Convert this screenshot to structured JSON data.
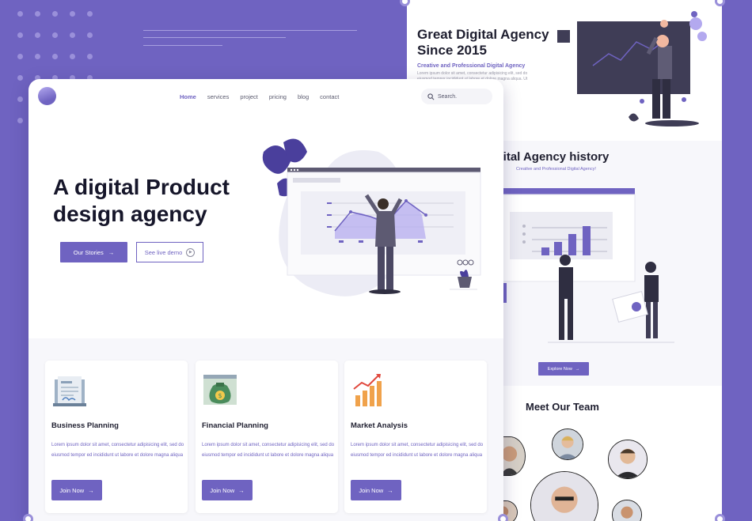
{
  "colors": {
    "brand": "#6f63c1",
    "background": "#6f63c1",
    "text_dark": "#1e1e2f"
  },
  "nav": {
    "items": [
      {
        "label": "Home",
        "active": true
      },
      {
        "label": "services",
        "active": false
      },
      {
        "label": "project",
        "active": false
      },
      {
        "label": "pricing",
        "active": false
      },
      {
        "label": "blog",
        "active": false
      },
      {
        "label": "contact",
        "active": false
      }
    ],
    "search_placeholder": "Search.",
    "search_icon": "search-icon"
  },
  "hero": {
    "title": "A digital Product design agency",
    "primary_button": "Our Stories",
    "secondary_button": "See live demo"
  },
  "cards": [
    {
      "title": "Business Planning",
      "text": "Lorem ipsum dolor sit amet, consectetur adipisicing elit, sed do eiusmod tempor ed incididunt ut labore et dolore magna aliqua",
      "button": "Join Now",
      "icon": "document-icon"
    },
    {
      "title": "Financial Planning",
      "text": "Lorem ipsum dolor sit amet, consectetur adipisicing elit, sed do eiusmod tempor ed incididunt ut labore et dolore magna aliqua",
      "button": "Join Now",
      "icon": "money-bag-icon"
    },
    {
      "title": "Market Analysis",
      "text": "Lorem ipsum dolor sit amet, consectetur adipisicing elit, sed do eiusmod tempor ed incididunt ut labore et dolore magna aliqua",
      "button": "Join Now",
      "icon": "growth-chart-icon"
    }
  ],
  "back_page": {
    "title": "Great Digital Agency Since 2015",
    "subtitle": "Creative and Professional Digital Agency",
    "lorem": "Lorem ipsum dolor sit amet, consectetur adipisicing elit, sed do eiusmod tempor incididunt ut labore et dolore magna aliqua. Ut enim labore et dolore magna aliqua",
    "history_title": "at Digital Agency history",
    "history_subtitle": "Creative and Professional Digital Agency!",
    "explore_button": "Explore Now",
    "team_title": "Meet Our Team"
  }
}
